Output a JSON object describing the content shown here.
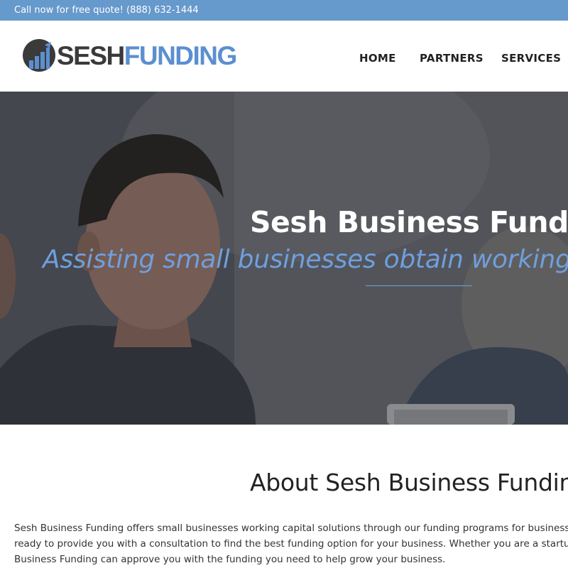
{
  "topbar": {
    "call_text": "Call now for free quote! (888) 632-1444"
  },
  "header": {
    "logo_part1": "SESH",
    "logo_part2": "FUNDING",
    "nav": [
      {
        "label": "HOME"
      },
      {
        "label": "PARTNERS"
      },
      {
        "label": "SERVICES"
      }
    ]
  },
  "hero": {
    "title": "Sesh Business Funding",
    "subtitle": "Assisting small businesses obtain working capital"
  },
  "about": {
    "title": "About Sesh Business Funding",
    "lines": [
      "Sesh Business Funding offers small businesses working capital solutions through our funding programs for  business loans",
      "ready to provide you with a consultation to find the best funding option for your business. Whether you are a startup in",
      "Business Funding can approve you with the funding you need to help grow your business."
    ]
  },
  "colors": {
    "topbar": "#6699cc",
    "accent": "#5b8fd0",
    "logo_dark": "#3a3a3a"
  }
}
